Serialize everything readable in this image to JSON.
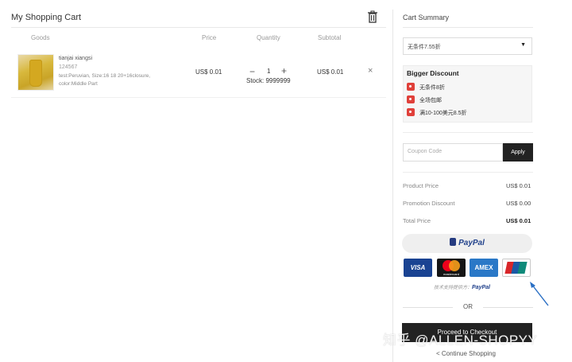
{
  "cart": {
    "title": "My Shopping Cart",
    "columns": [
      "Goods",
      "Price",
      "Quantity",
      "Subtotal"
    ],
    "items": [
      {
        "name": "tianjai xiangsi",
        "code": "124567",
        "attrs_line1": "test:Peruvian, Size:16 18 20+16closure,",
        "attrs_line2": "color:Middle Part",
        "price": "US$ 0.01",
        "qty_minus": "−",
        "quantity": "1",
        "qty_plus": "+",
        "stock": "Stock: 9999999",
        "subtotal": "US$ 0.01",
        "remove": "×"
      }
    ]
  },
  "summary": {
    "title": "Cart Summary",
    "promo_select": "无条件7.55折",
    "bigger_discount_title": "Bigger Discount",
    "discounts": [
      "无条件8折",
      "全场包邮",
      "满10-100美元8.5折"
    ],
    "coupon_placeholder": "Coupon Code",
    "apply_label": "Apply",
    "rows": [
      {
        "label": "Product Price",
        "value": "US$ 0.01"
      },
      {
        "label": "Promotion Discount",
        "value": "US$ 0.00"
      },
      {
        "label": "Total Price",
        "value": "US$ 0.01"
      }
    ],
    "paypal_label": "PayPal",
    "cards": [
      "VISA",
      "mastercard",
      "AMEX",
      "UnionPay"
    ],
    "powered_prefix": "技术支持提供方：",
    "powered_brand": "PayPal",
    "or_label": "OR",
    "checkout_label": "Proceed to Checkout",
    "continue_label": "< Continue Shopping"
  },
  "watermark": "知乎 @ALLEN-SHOPYY",
  "colors": {
    "accent_dark": "#222222",
    "paypal_blue": "#1e3f8a",
    "tag_red": "#e0403a",
    "annotation_arrow": "#2a6fc4"
  }
}
